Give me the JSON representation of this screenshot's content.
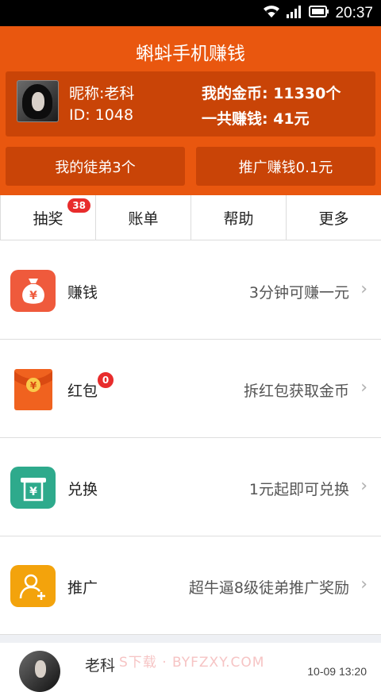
{
  "status_bar": {
    "time": "20:37",
    "icons": [
      "wifi-icon",
      "signal-icon",
      "battery-icon"
    ]
  },
  "header": {
    "title": "蝌蚪手机赚钱",
    "profile": {
      "nickname": "昵称:老科",
      "id": "ID: 1048",
      "coins": "我的金币: 11330个",
      "total_earned": "一共赚钱: 41元"
    },
    "buttons": {
      "apprentices": "我的徒弟3个",
      "promote": "推广赚钱0.1元"
    },
    "colors": {
      "primary": "#e9570f",
      "card": "#c94407"
    }
  },
  "tabs": [
    {
      "label": "抽奖",
      "badge": "38"
    },
    {
      "label": "账单"
    },
    {
      "label": "帮助"
    },
    {
      "label": "更多"
    }
  ],
  "menu": [
    {
      "label": "赚钱",
      "desc": "3分钟可赚一元",
      "icon": "money-bag-icon",
      "color": "#ef5a3c",
      "glyph": "¥"
    },
    {
      "label": "红包",
      "desc": "拆红包获取金币",
      "icon": "red-envelope-icon",
      "color": "#f0621f",
      "badge": "0",
      "glyph": "¥"
    },
    {
      "label": "兑换",
      "desc": "1元起即可兑换",
      "icon": "exchange-icon",
      "color": "#2eaa8c",
      "glyph": "¥"
    },
    {
      "label": "推广",
      "desc": "超牛逼8级徒弟推广奖励",
      "icon": "add-user-icon",
      "color": "#f3a30c"
    }
  ],
  "feed": {
    "name": "老科",
    "time": "10-09 13:20",
    "watermark": "S下载 · BYFZXY.COM"
  },
  "chevron": "›"
}
